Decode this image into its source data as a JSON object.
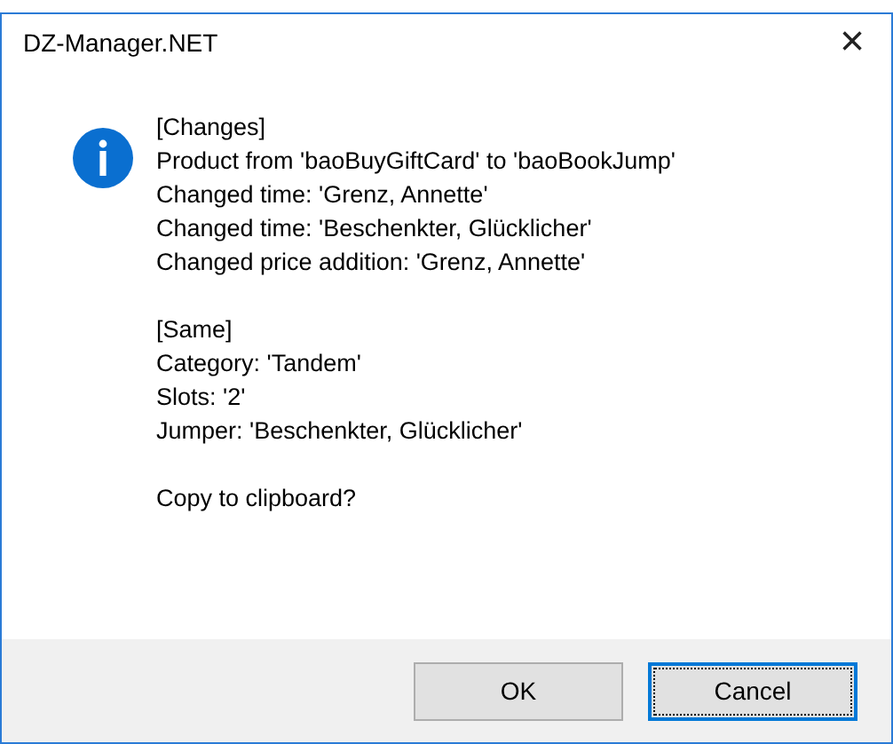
{
  "window": {
    "title": "DZ-Manager.NET",
    "close": "×"
  },
  "message": {
    "sections": [
      {
        "lines": [
          "[Changes]",
          "Product from 'baoBuyGiftCard' to 'baoBookJump'",
          "Changed time: 'Grenz, Annette'",
          "Changed time: 'Beschenkter, Glücklicher'",
          "Changed price addition: 'Grenz, Annette'"
        ]
      },
      {
        "lines": [
          "[Same]",
          "Category: 'Tandem'",
          "Slots: '2'",
          "Jumper: 'Beschenkter, Glücklicher'"
        ]
      },
      {
        "lines": [
          "Copy to clipboard?"
        ]
      }
    ]
  },
  "buttons": [
    {
      "label": "OK",
      "focused": false
    },
    {
      "label": "Cancel",
      "focused": true
    }
  ]
}
